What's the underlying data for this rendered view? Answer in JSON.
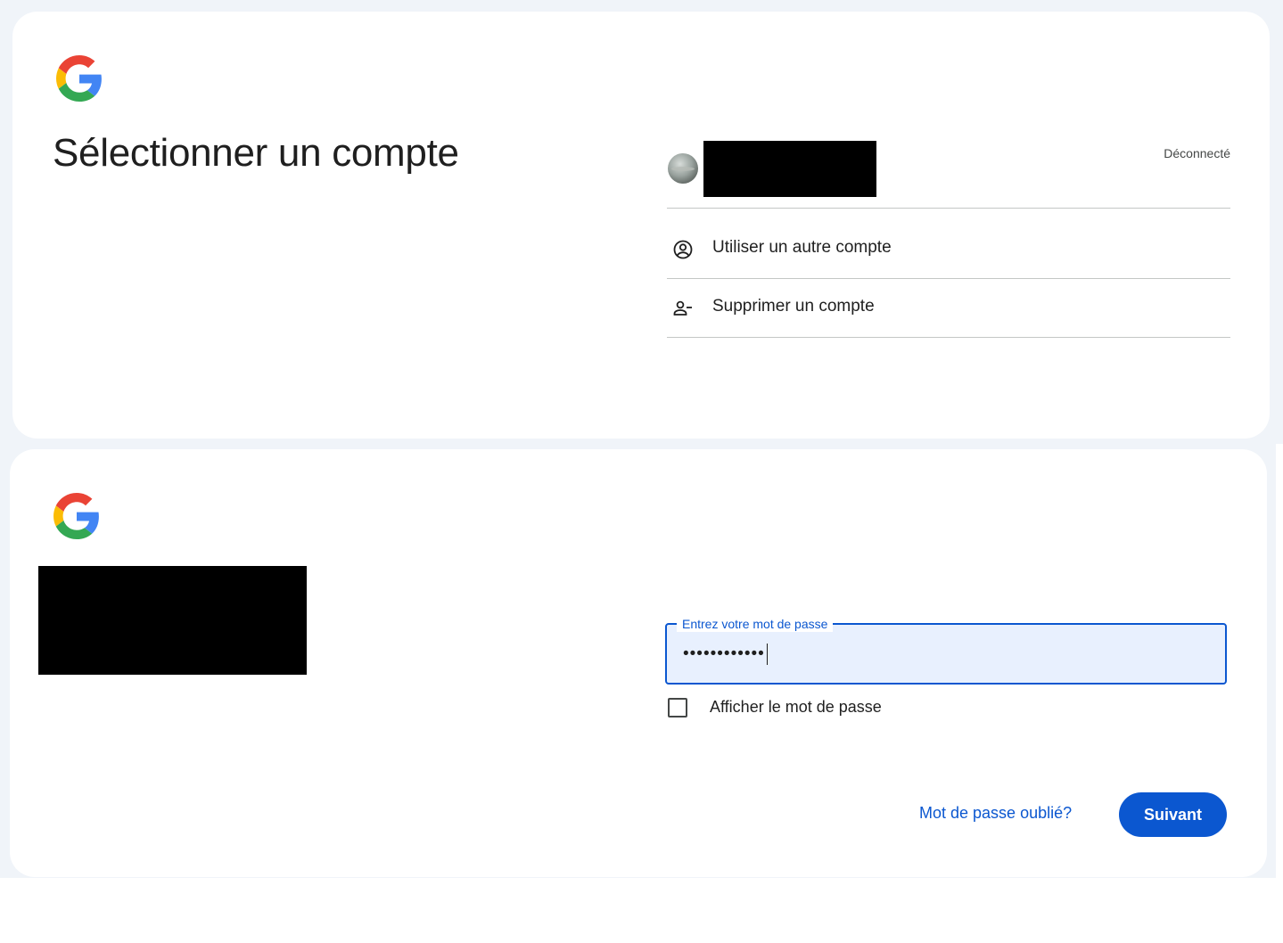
{
  "brand": {
    "logo_icon": "google-g-logo",
    "colors": {
      "blue": "#4285F4",
      "red": "#EA4335",
      "yellow": "#FBBC05",
      "green": "#34A853"
    }
  },
  "account_chooser": {
    "title": "Sélectionner un compte",
    "account": {
      "avatar_icon": "avatar-photo",
      "identity_redacted": true,
      "status": "Déconnecté"
    },
    "actions": [
      {
        "label": "Utiliser un autre compte",
        "icon": "account-circle-icon"
      },
      {
        "label": "Supprimer un compte",
        "icon": "person-remove-icon"
      }
    ]
  },
  "password_page": {
    "identity_redacted": true,
    "password_field": {
      "label": "Entrez votre mot de passe",
      "value": "••••••••••••"
    },
    "show_password": {
      "label": "Afficher le mot de passe",
      "checked": false
    },
    "forgot_link": "Mot de passe oublié?",
    "next_button": "Suivant",
    "accent_color": "#0b57d0"
  }
}
